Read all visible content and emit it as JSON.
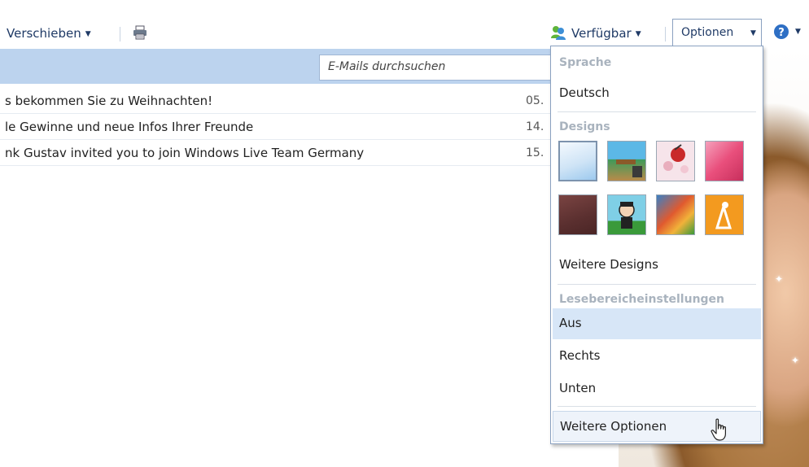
{
  "toolbar": {
    "move_label": "Verschieben",
    "status_label": "Verfügbar",
    "options_label": "Optionen"
  },
  "search": {
    "placeholder": "E-Mails durchsuchen"
  },
  "messages": [
    {
      "subject": "s bekommen Sie zu Weihnachten!",
      "date": "05."
    },
    {
      "subject": "le Gewinne und neue Infos Ihrer Freunde",
      "date": "14."
    },
    {
      "subject": "nk Gustav invited you to join Windows Live Team Germany",
      "date": "15."
    }
  ],
  "options_menu": {
    "language_heading": "Sprache",
    "language_value": "Deutsch",
    "designs_heading": "Designs",
    "designs": [
      {
        "icon": "design-sky-icon",
        "colors": [
          "#e9f3fb",
          "#9cc9ee"
        ]
      },
      {
        "icon": "design-beach-icon",
        "colors": [
          "#5cb8e6",
          "#b98b4a"
        ]
      },
      {
        "icon": "design-flowers-icon",
        "colors": [
          "#f6e4ea",
          "#c92a2a"
        ]
      },
      {
        "icon": "design-pink-icon",
        "colors": [
          "#e94f7c",
          "#f5a0bb"
        ]
      },
      {
        "icon": "design-maroon-icon",
        "colors": [
          "#5a2f2f",
          "#8a4a48"
        ]
      },
      {
        "icon": "design-cartoon-icon",
        "colors": [
          "#7fcfe6",
          "#3a9a3a"
        ]
      },
      {
        "icon": "design-plane-icon",
        "colors": [
          "#d84b2f",
          "#3a7fc4"
        ]
      },
      {
        "icon": "design-orange-icon",
        "colors": [
          "#f39a1f",
          "#ffffff"
        ]
      }
    ],
    "more_designs": "Weitere Designs",
    "reading_pane_heading": "Lesebereicheinstellungen",
    "reading_pane_options": [
      "Aus",
      "Rechts",
      "Unten"
    ],
    "selected_reading_pane": "Aus",
    "more_options": "Weitere Optionen"
  },
  "colors": {
    "header_band": "#bcd3ee",
    "selection": "#d7e6f7",
    "link_text": "#1f3a66"
  }
}
